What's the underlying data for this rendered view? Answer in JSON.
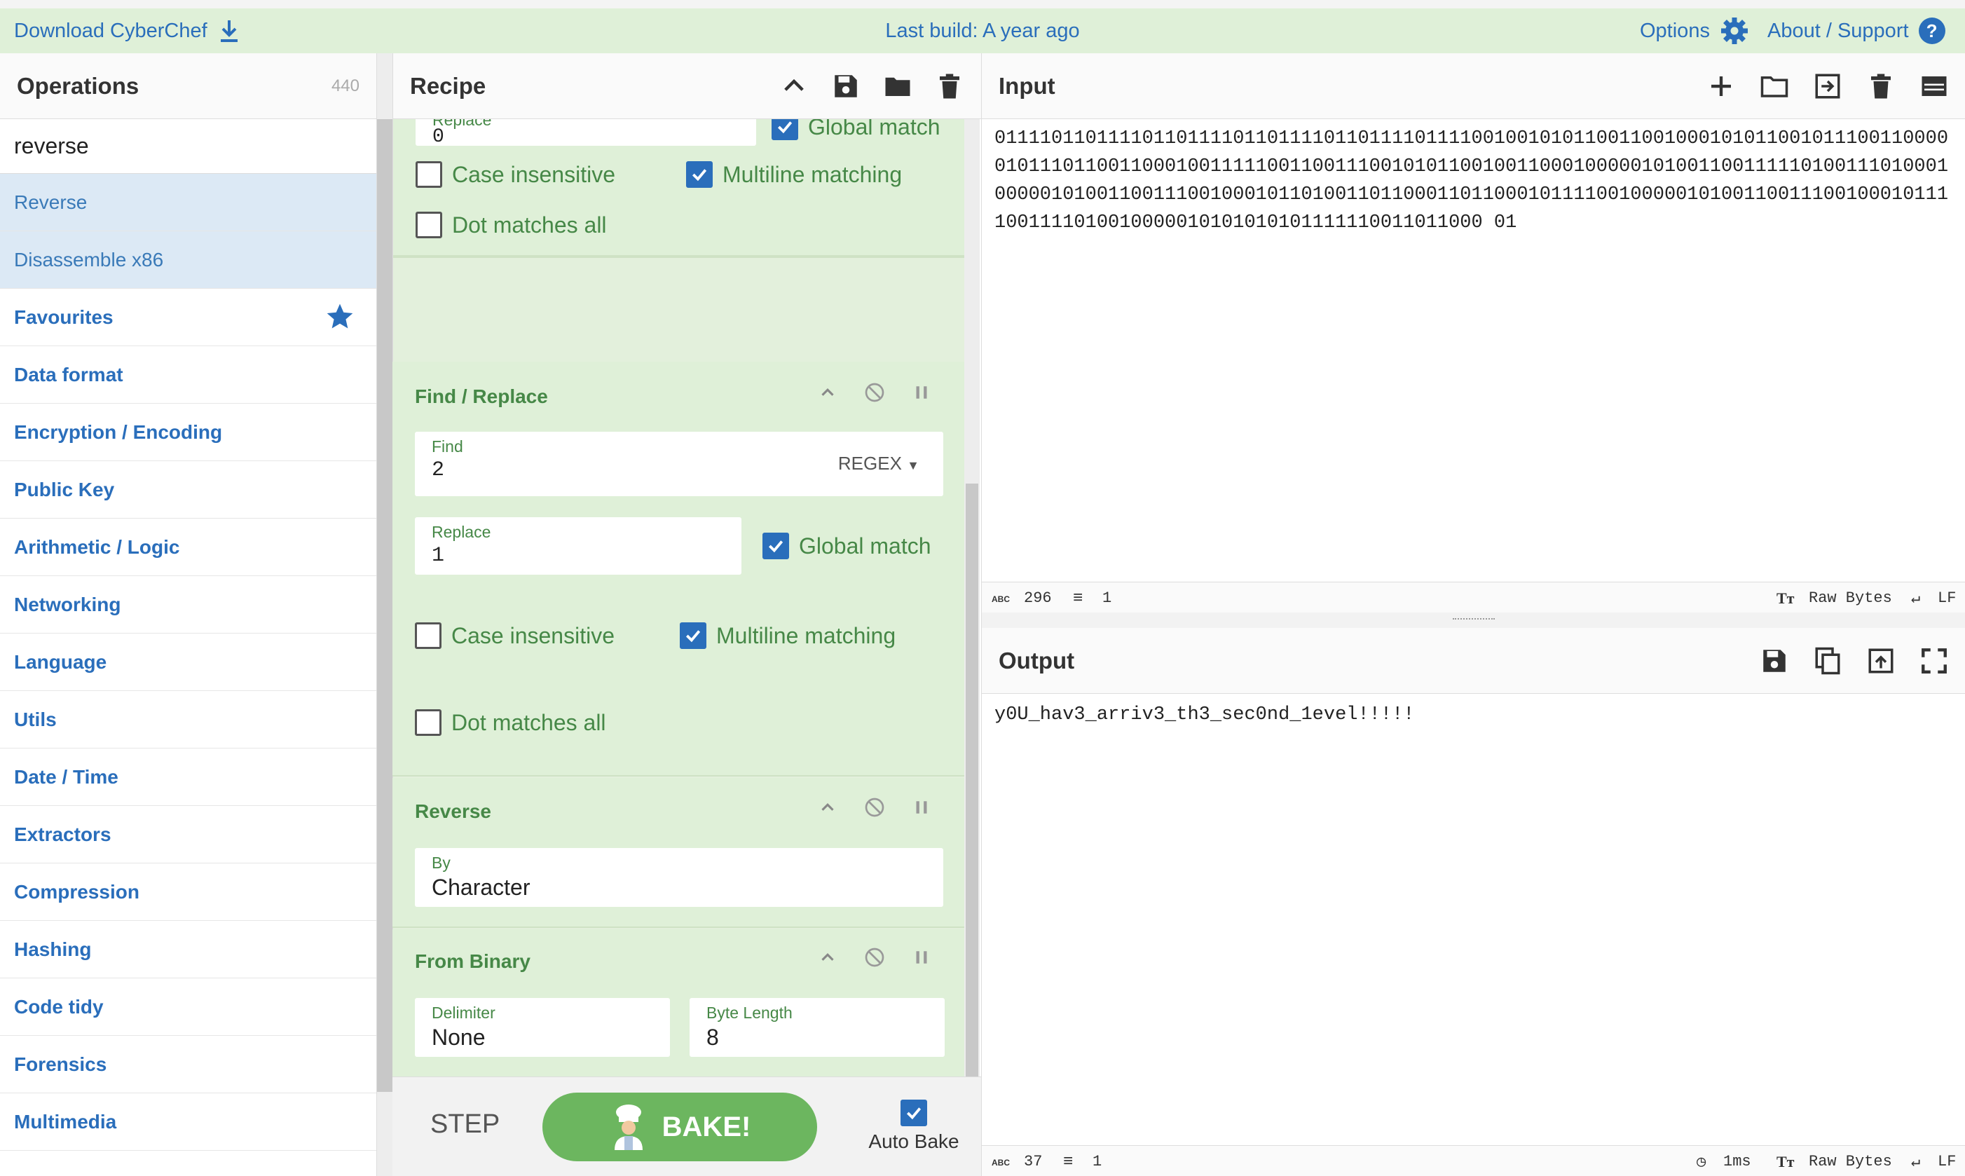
{
  "topbar": {
    "download_label": "Download CyberChef",
    "build_label": "Last build: A year ago",
    "options_label": "Options",
    "about_label": "About / Support"
  },
  "operations": {
    "title": "Operations",
    "count": "440",
    "search_value": "reverse",
    "results": [
      "Reverse",
      "Disassemble x86"
    ],
    "categories": [
      "Favourites",
      "Data format",
      "Encryption / Encoding",
      "Public Key",
      "Arithmetic / Logic",
      "Networking",
      "Language",
      "Utils",
      "Date / Time",
      "Extractors",
      "Compression",
      "Hashing",
      "Code tidy",
      "Forensics",
      "Multimedia"
    ]
  },
  "recipe": {
    "title": "Recipe",
    "block0": {
      "replace_label": "Replace",
      "replace_value": "0",
      "global_match": "Global match",
      "case_insensitive": "Case insensitive",
      "multiline": "Multiline matching",
      "dot_all": "Dot matches all"
    },
    "find_replace": {
      "title": "Find / Replace",
      "find_label": "Find",
      "find_value": "2",
      "regex": "REGEX",
      "replace_label": "Replace",
      "replace_value": "1",
      "global_match": "Global match",
      "case_insensitive": "Case insensitive",
      "multiline": "Multiline matching",
      "dot_all": "Dot matches all"
    },
    "reverse": {
      "title": "Reverse",
      "by_label": "By",
      "by_value": "Character"
    },
    "from_binary": {
      "title": "From Binary",
      "delimiter_label": "Delimiter",
      "delimiter_value": "None",
      "byte_length_label": "Byte Length",
      "byte_length_value": "8"
    },
    "step_label": "STEP",
    "bake_label": "BAKE!",
    "autobake_label": "Auto Bake"
  },
  "input": {
    "title": "Input",
    "text": "0111101101111011011110110111101101111011110010010101100110010001010110010111001100000101110110011000100111110011001110010101100100110001000001010011001111101001110100010000010100110011100100010110100110110001101100010111100100000101001100111001000101111001111010010000010101010101111110011011000 01",
    "length": "296",
    "lines": "1",
    "encoding": "Raw Bytes",
    "eol": "LF"
  },
  "output": {
    "title": "Output",
    "text": "y0U_hav3_arriv3_th3_sec0nd_1evel!!!!!",
    "length": "37",
    "lines": "1",
    "time": "1ms",
    "encoding": "Raw Bytes",
    "eol": "LF"
  }
}
